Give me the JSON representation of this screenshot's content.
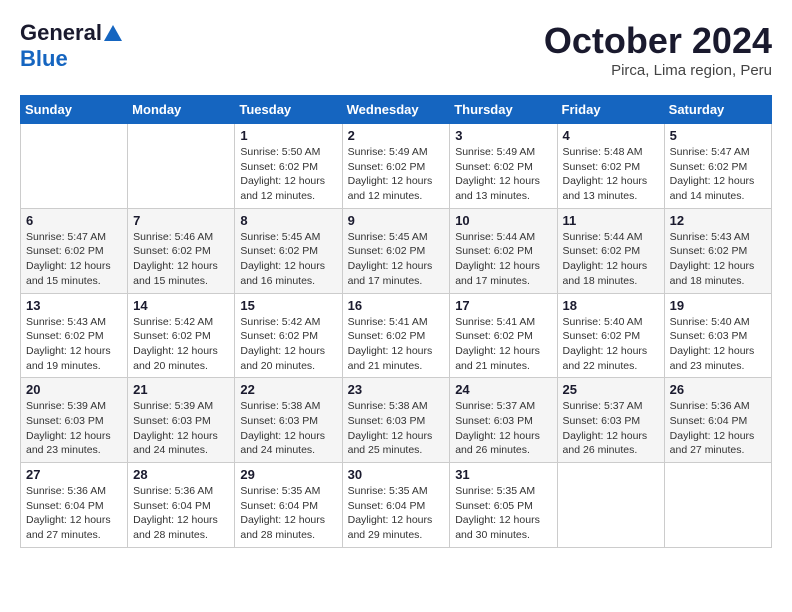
{
  "logo": {
    "line1": "General",
    "line2": "Blue"
  },
  "title": "October 2024",
  "subtitle": "Pirca, Lima region, Peru",
  "days_header": [
    "Sunday",
    "Monday",
    "Tuesday",
    "Wednesday",
    "Thursday",
    "Friday",
    "Saturday"
  ],
  "weeks": [
    [
      {
        "day": "",
        "info": ""
      },
      {
        "day": "",
        "info": ""
      },
      {
        "day": "1",
        "info": "Sunrise: 5:50 AM\nSunset: 6:02 PM\nDaylight: 12 hours\nand 12 minutes."
      },
      {
        "day": "2",
        "info": "Sunrise: 5:49 AM\nSunset: 6:02 PM\nDaylight: 12 hours\nand 12 minutes."
      },
      {
        "day": "3",
        "info": "Sunrise: 5:49 AM\nSunset: 6:02 PM\nDaylight: 12 hours\nand 13 minutes."
      },
      {
        "day": "4",
        "info": "Sunrise: 5:48 AM\nSunset: 6:02 PM\nDaylight: 12 hours\nand 13 minutes."
      },
      {
        "day": "5",
        "info": "Sunrise: 5:47 AM\nSunset: 6:02 PM\nDaylight: 12 hours\nand 14 minutes."
      }
    ],
    [
      {
        "day": "6",
        "info": "Sunrise: 5:47 AM\nSunset: 6:02 PM\nDaylight: 12 hours\nand 15 minutes."
      },
      {
        "day": "7",
        "info": "Sunrise: 5:46 AM\nSunset: 6:02 PM\nDaylight: 12 hours\nand 15 minutes."
      },
      {
        "day": "8",
        "info": "Sunrise: 5:45 AM\nSunset: 6:02 PM\nDaylight: 12 hours\nand 16 minutes."
      },
      {
        "day": "9",
        "info": "Sunrise: 5:45 AM\nSunset: 6:02 PM\nDaylight: 12 hours\nand 17 minutes."
      },
      {
        "day": "10",
        "info": "Sunrise: 5:44 AM\nSunset: 6:02 PM\nDaylight: 12 hours\nand 17 minutes."
      },
      {
        "day": "11",
        "info": "Sunrise: 5:44 AM\nSunset: 6:02 PM\nDaylight: 12 hours\nand 18 minutes."
      },
      {
        "day": "12",
        "info": "Sunrise: 5:43 AM\nSunset: 6:02 PM\nDaylight: 12 hours\nand 18 minutes."
      }
    ],
    [
      {
        "day": "13",
        "info": "Sunrise: 5:43 AM\nSunset: 6:02 PM\nDaylight: 12 hours\nand 19 minutes."
      },
      {
        "day": "14",
        "info": "Sunrise: 5:42 AM\nSunset: 6:02 PM\nDaylight: 12 hours\nand 20 minutes."
      },
      {
        "day": "15",
        "info": "Sunrise: 5:42 AM\nSunset: 6:02 PM\nDaylight: 12 hours\nand 20 minutes."
      },
      {
        "day": "16",
        "info": "Sunrise: 5:41 AM\nSunset: 6:02 PM\nDaylight: 12 hours\nand 21 minutes."
      },
      {
        "day": "17",
        "info": "Sunrise: 5:41 AM\nSunset: 6:02 PM\nDaylight: 12 hours\nand 21 minutes."
      },
      {
        "day": "18",
        "info": "Sunrise: 5:40 AM\nSunset: 6:02 PM\nDaylight: 12 hours\nand 22 minutes."
      },
      {
        "day": "19",
        "info": "Sunrise: 5:40 AM\nSunset: 6:03 PM\nDaylight: 12 hours\nand 23 minutes."
      }
    ],
    [
      {
        "day": "20",
        "info": "Sunrise: 5:39 AM\nSunset: 6:03 PM\nDaylight: 12 hours\nand 23 minutes."
      },
      {
        "day": "21",
        "info": "Sunrise: 5:39 AM\nSunset: 6:03 PM\nDaylight: 12 hours\nand 24 minutes."
      },
      {
        "day": "22",
        "info": "Sunrise: 5:38 AM\nSunset: 6:03 PM\nDaylight: 12 hours\nand 24 minutes."
      },
      {
        "day": "23",
        "info": "Sunrise: 5:38 AM\nSunset: 6:03 PM\nDaylight: 12 hours\nand 25 minutes."
      },
      {
        "day": "24",
        "info": "Sunrise: 5:37 AM\nSunset: 6:03 PM\nDaylight: 12 hours\nand 26 minutes."
      },
      {
        "day": "25",
        "info": "Sunrise: 5:37 AM\nSunset: 6:03 PM\nDaylight: 12 hours\nand 26 minutes."
      },
      {
        "day": "26",
        "info": "Sunrise: 5:36 AM\nSunset: 6:04 PM\nDaylight: 12 hours\nand 27 minutes."
      }
    ],
    [
      {
        "day": "27",
        "info": "Sunrise: 5:36 AM\nSunset: 6:04 PM\nDaylight: 12 hours\nand 27 minutes."
      },
      {
        "day": "28",
        "info": "Sunrise: 5:36 AM\nSunset: 6:04 PM\nDaylight: 12 hours\nand 28 minutes."
      },
      {
        "day": "29",
        "info": "Sunrise: 5:35 AM\nSunset: 6:04 PM\nDaylight: 12 hours\nand 28 minutes."
      },
      {
        "day": "30",
        "info": "Sunrise: 5:35 AM\nSunset: 6:04 PM\nDaylight: 12 hours\nand 29 minutes."
      },
      {
        "day": "31",
        "info": "Sunrise: 5:35 AM\nSunset: 6:05 PM\nDaylight: 12 hours\nand 30 minutes."
      },
      {
        "day": "",
        "info": ""
      },
      {
        "day": "",
        "info": ""
      }
    ]
  ]
}
